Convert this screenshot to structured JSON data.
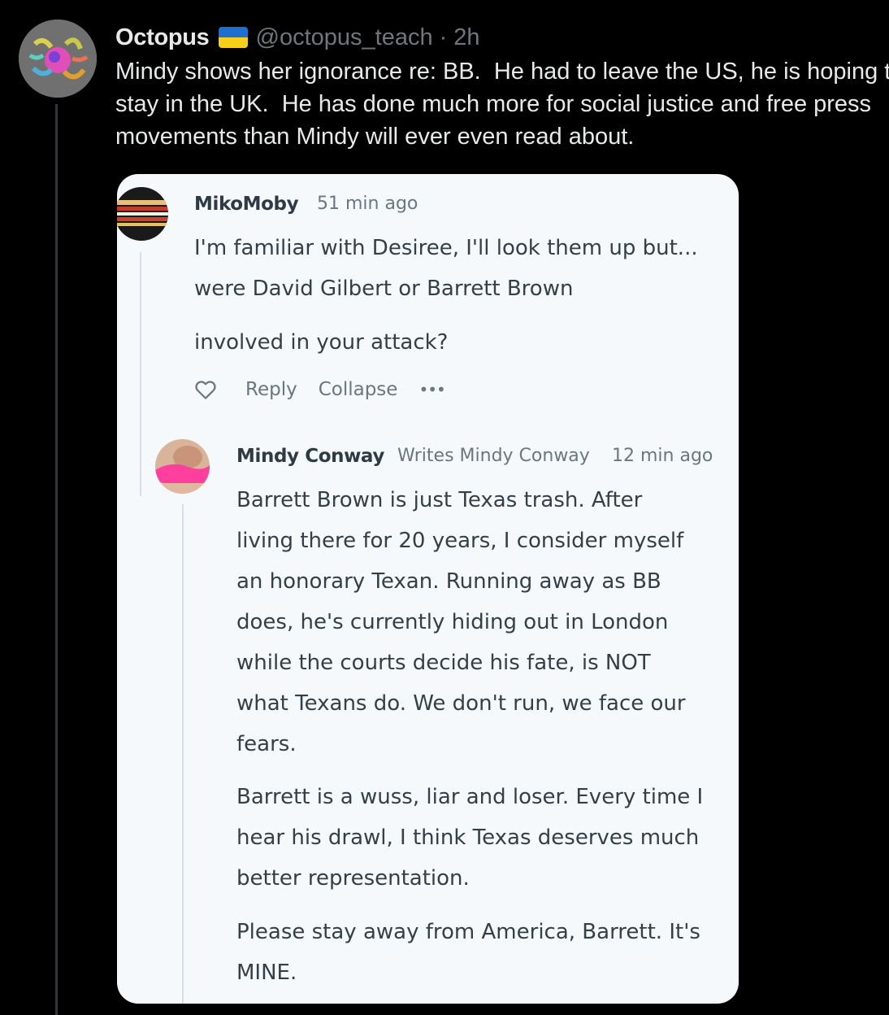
{
  "tweet": {
    "display_name": "Octopus",
    "flag": "ukraine-flag",
    "handle": "@octopus_teach",
    "separator": "·",
    "time": "2h",
    "lines": [
      "Mindy shows her ignorance re: BB.  He had to leave the US, he is hoping to",
      "stay in the UK.  He has done much more for social justice and free press",
      "movements than Mindy will ever even read about."
    ]
  },
  "embedded": {
    "comment1": {
      "author": "MikoMoby",
      "time": "51 min ago",
      "lines": [
        "I'm familiar with Desiree, I'll look them up but...",
        "were David Gilbert or Barrett Brown"
      ],
      "line3": "involved in your attack?",
      "actions": {
        "like_icon": "heart-icon",
        "reply": "Reply",
        "collapse": "Collapse",
        "more": "•••"
      }
    },
    "comment2": {
      "author": "Mindy Conway",
      "subtitle": "Writes Mindy Conway",
      "time": "12 min ago",
      "paragraph1": [
        "Barrett Brown is just Texas trash. After",
        "living there for 20 years, I consider myself",
        "an honorary Texan. Running away as BB",
        "does, he's currently hiding out in London",
        "while the courts decide his fate, is NOT",
        "what Texans do. We don't run, we face our",
        "fears."
      ],
      "paragraph2": [
        "Barrett is a wuss, liar and loser. Every time I",
        "hear his drawl, I think Texas deserves much",
        "better representation."
      ],
      "paragraph3": [
        "Please stay away from America, Barrett. It's",
        "MINE."
      ]
    }
  },
  "colors": {
    "background": "#000000",
    "primary_text": "#e7e9ea",
    "secondary_text": "#71767b",
    "card_background": "#f5f9fc",
    "accent_pink": "#ff3f9d"
  }
}
